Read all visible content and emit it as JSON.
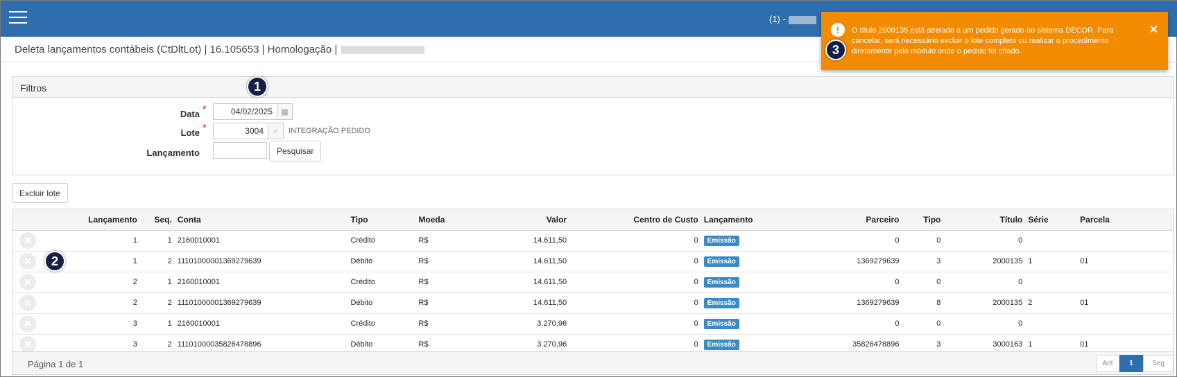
{
  "header": {
    "user_label": "(1) -"
  },
  "page": {
    "title": "Deleta lançamentos contábeis (CtDltLot) | 16.105653 | Homologação |"
  },
  "filters": {
    "title": "Filtros",
    "data_label": "Data",
    "data_value": "04/02/2025",
    "lote_label": "Lote",
    "lote_value": "3004",
    "lote_desc": "INTEGRAÇÃO PEDIDO",
    "lancamento_label": "Lançamento",
    "lancamento_value": "",
    "search_button": "Pesquisar",
    "required_mark": "*"
  },
  "actions": {
    "delete_lot": "Excluir lote"
  },
  "table": {
    "columns": [
      "Lançamento",
      "Seq.",
      "Conta",
      "Tipo",
      "Moeda",
      "Valor",
      "Centro de Custo",
      "Lançamento",
      "Parceiro",
      "Tipo",
      "Título",
      "Série",
      "Parcela"
    ],
    "rows": [
      [
        "1",
        "1",
        "2160010001",
        "Crédito",
        "R$",
        "14.611,50",
        "0",
        "Emissão",
        "0",
        "0",
        "0",
        "",
        ""
      ],
      [
        "1",
        "2",
        "11101000001369279639",
        "Débito",
        "R$",
        "14.611,50",
        "0",
        "Emissão",
        "1369279639",
        "3",
        "2000135",
        "1",
        "01"
      ],
      [
        "2",
        "1",
        "2160010001",
        "Crédito",
        "R$",
        "14.611,50",
        "0",
        "Emissão",
        "0",
        "0",
        "0",
        "",
        ""
      ],
      [
        "2",
        "2",
        "11101000001369279639",
        "Débito",
        "R$",
        "14.611,50",
        "0",
        "Emissão",
        "1369279639",
        "8",
        "2000135",
        "2",
        "01"
      ],
      [
        "3",
        "1",
        "2160010001",
        "Crédito",
        "R$",
        "3.270,96",
        "0",
        "Emissão",
        "0",
        "0",
        "0",
        "",
        ""
      ],
      [
        "3",
        "2",
        "11101000035826478896",
        "Débito",
        "R$",
        "3.270,96",
        "0",
        "Emissão",
        "35826478896",
        "3",
        "3000163",
        "1",
        "01"
      ]
    ]
  },
  "pagination": {
    "info": "Página 1 de 1",
    "prev": "Ant",
    "current": "1",
    "next": "Seg"
  },
  "toast": {
    "message": "O título 2000135 está atrelado a um pedido gerado no sistema DECOR. Para cancelar, será necessário excluir o lote completo ou realizar o procedimento diretamente pelo módulo onde o pedido foi criado.",
    "icon": "!",
    "close": "✕"
  },
  "markers": [
    "1",
    "2",
    "3"
  ],
  "colors": {
    "header": "#2f6ead",
    "toast": "#f18b00",
    "badge": "#3a8ac6",
    "marker": "#152044"
  }
}
